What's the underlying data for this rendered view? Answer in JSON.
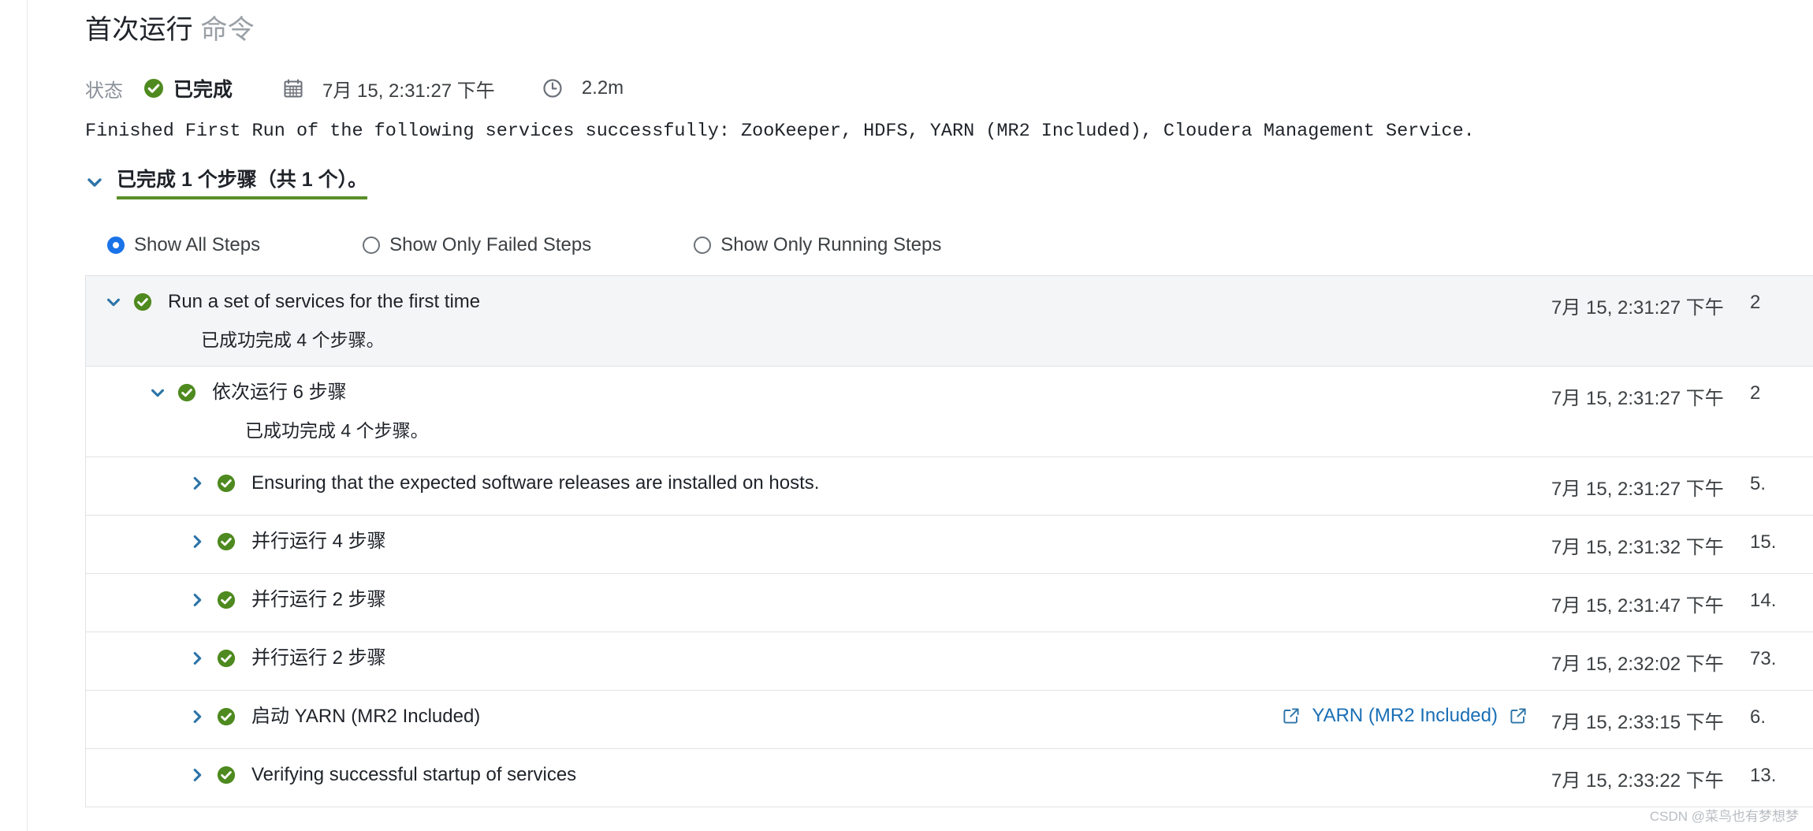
{
  "header": {
    "title_main": "首次运行",
    "title_sub": "命令",
    "status_label": "状态",
    "status_value": "已完成",
    "calendar_icon": "calendar-icon",
    "started_at": "7月 15, 2:31:27 下午",
    "clock_icon": "clock-icon",
    "duration": "2.2m",
    "description": "Finished First Run of the following services successfully: ZooKeeper, HDFS, YARN (MR2 Included), Cloudera Management Service."
  },
  "summary": {
    "toggle_icon": "chevron-down-icon",
    "text": "已完成 1 个步骤（共 1 个）。",
    "underline_color": "#5a8f29"
  },
  "filters": {
    "options": [
      {
        "label": "Show All Steps",
        "selected": true
      },
      {
        "label": "Show Only Failed Steps",
        "selected": false
      },
      {
        "label": "Show Only Running Steps",
        "selected": false
      }
    ],
    "accent_color": "#1a73e8"
  },
  "steps": [
    {
      "level": 0,
      "twisty": "chevron-down-icon",
      "status": "success-check-icon",
      "title": "Run a set of services for the first time",
      "subtitle": "已成功完成  4  个步骤。",
      "time": "7月 15, 2:31:27 下午",
      "duration": "2",
      "links": []
    },
    {
      "level": 1,
      "twisty": "chevron-down-icon",
      "status": "success-check-icon",
      "title": "依次运行 6 步骤",
      "subtitle": "已成功完成  4  个步骤。",
      "time": "7月 15, 2:31:27 下午",
      "duration": "2",
      "links": []
    },
    {
      "level": 2,
      "twisty": "chevron-right-icon",
      "status": "success-check-icon",
      "title": "Ensuring that the expected software releases are installed on hosts.",
      "subtitle": "",
      "time": "7月 15, 2:31:27 下午",
      "duration": "5.",
      "links": []
    },
    {
      "level": 2,
      "twisty": "chevron-right-icon",
      "status": "success-check-icon",
      "title": "并行运行 4 步骤",
      "subtitle": "",
      "time": "7月 15, 2:31:32 下午",
      "duration": "15.",
      "links": []
    },
    {
      "level": 2,
      "twisty": "chevron-right-icon",
      "status": "success-check-icon",
      "title": "并行运行 2 步骤",
      "subtitle": "",
      "time": "7月 15, 2:31:47 下午",
      "duration": "14.",
      "links": []
    },
    {
      "level": 2,
      "twisty": "chevron-right-icon",
      "status": "success-check-icon",
      "title": "并行运行 2 步骤",
      "subtitle": "",
      "time": "7月 15, 2:32:02 下午",
      "duration": "73.",
      "links": []
    },
    {
      "level": 2,
      "twisty": "chevron-right-icon",
      "status": "success-check-icon",
      "title": "启动 YARN (MR2 Included)",
      "subtitle": "",
      "time": "7月 15, 2:33:15 下午",
      "duration": "6.",
      "links": [
        {
          "leading_icon": "external-link-icon",
          "label": "YARN (MR2 Included)",
          "trailing_icon": "external-link-icon"
        }
      ]
    },
    {
      "level": 2,
      "twisty": "chevron-right-icon",
      "status": "success-check-icon",
      "title": "Verifying successful startup of services",
      "subtitle": "",
      "time": "7月 15, 2:33:22 下午",
      "duration": "13.",
      "links": []
    }
  ],
  "watermark": "CSDN @菜鸟也有梦想梦"
}
